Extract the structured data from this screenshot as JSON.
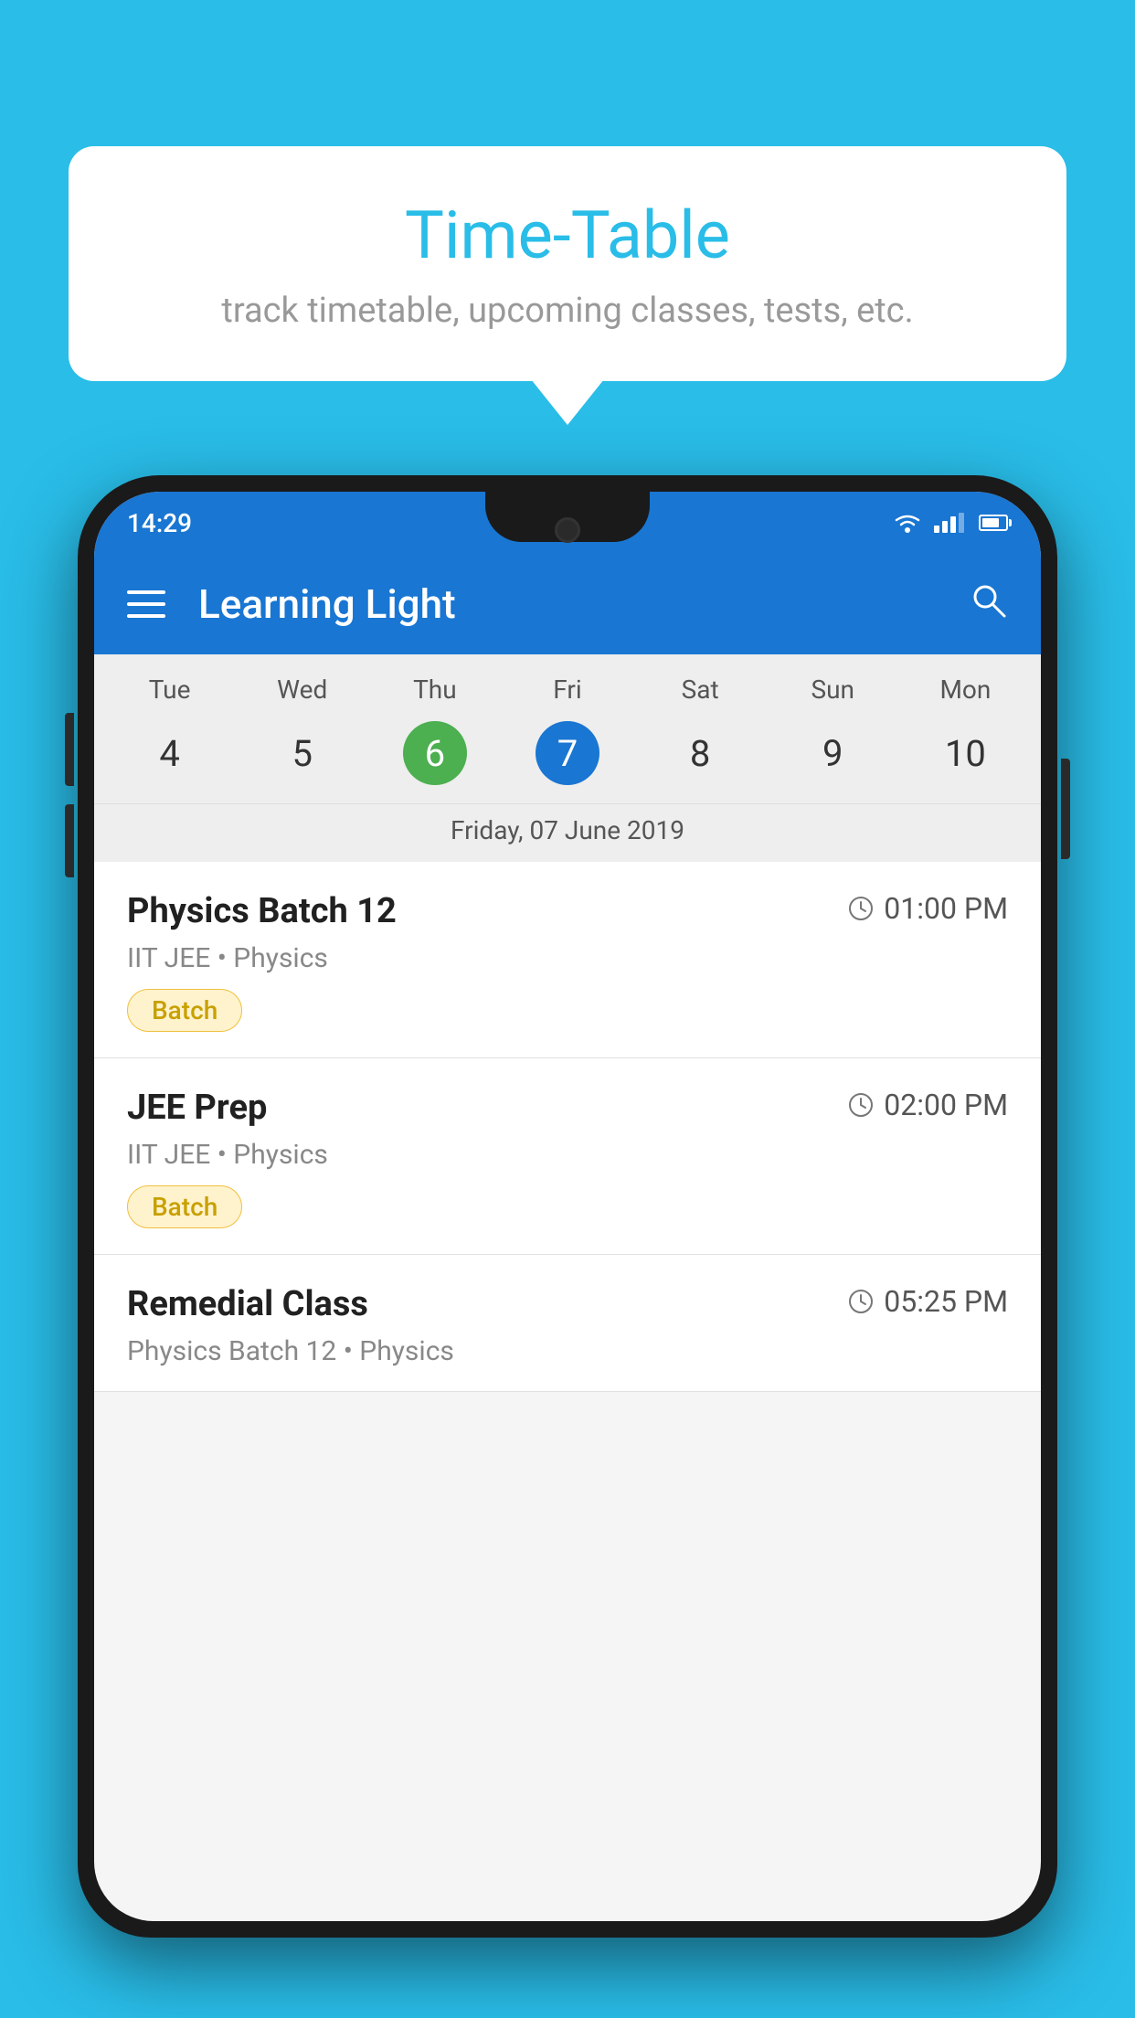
{
  "background": {
    "color": "#29bde8"
  },
  "bubble": {
    "title": "Time-Table",
    "subtitle": "track timetable, upcoming classes, tests, etc."
  },
  "phone": {
    "status_bar": {
      "time": "14:29",
      "icons": [
        "wifi",
        "signal",
        "battery"
      ]
    },
    "app_bar": {
      "title": "Learning Light",
      "hamburger_label": "menu",
      "search_label": "search"
    },
    "calendar": {
      "days": [
        "Tue",
        "Wed",
        "Thu",
        "Fri",
        "Sat",
        "Sun",
        "Mon"
      ],
      "dates": [
        "4",
        "5",
        "6",
        "7",
        "8",
        "9",
        "10"
      ],
      "today_index": 2,
      "selected_index": 3,
      "selected_date_label": "Friday, 07 June 2019"
    },
    "schedule": [
      {
        "title": "Physics Batch 12",
        "time": "01:00 PM",
        "subject": "IIT JEE • Physics",
        "tag": "Batch"
      },
      {
        "title": "JEE Prep",
        "time": "02:00 PM",
        "subject": "IIT JEE • Physics",
        "tag": "Batch"
      },
      {
        "title": "Remedial Class",
        "time": "05:25 PM",
        "subject": "Physics Batch 12 • Physics",
        "tag": ""
      }
    ]
  }
}
